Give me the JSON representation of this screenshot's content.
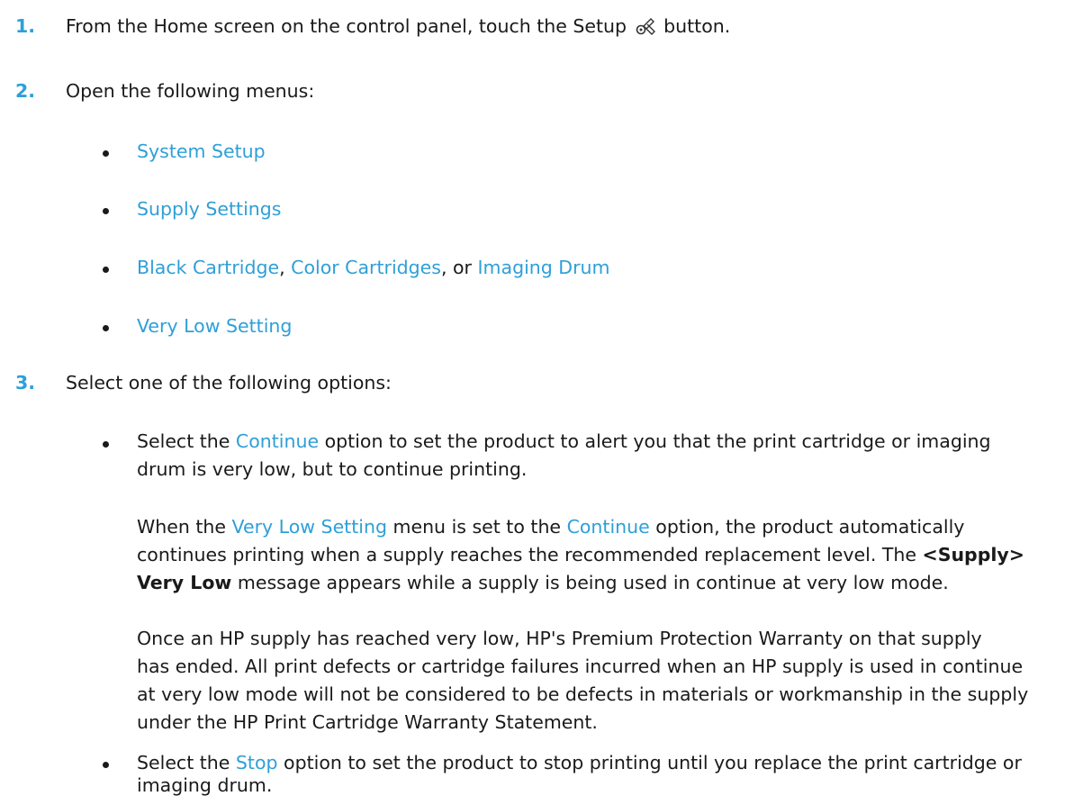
{
  "step1": {
    "number": "1.",
    "text_before": "From the Home screen on the control panel, touch the Setup",
    "icon": "setup-wrench-icon",
    "text_after": "button."
  },
  "step2": {
    "number": "2.",
    "text": "Open the following menus:",
    "menus": [
      {
        "a": "System Setup"
      },
      {
        "a": "Supply Settings"
      },
      {
        "a": "Black Cartridge",
        "sep1": ", ",
        "b": "Color Cartridges",
        "sep2": ", or ",
        "c": "Imaging Drum"
      },
      {
        "a": "Very Low Setting"
      }
    ]
  },
  "step3": {
    "number": "3.",
    "text": "Select one of the following options:",
    "continue_option": {
      "l1_a": "Select the ",
      "l1_link": "Continue",
      "l1_b": " option to set the product to alert you that the print cartridge or imaging",
      "l2": "drum is very low, but to continue printing."
    },
    "para1": {
      "l1_a": "When the ",
      "l1_link1": "Very Low Setting",
      "l1_b": " menu is set to the ",
      "l1_link2": "Continue",
      "l1_c": " option, the product automatically",
      "l2_a": "continues printing when a supply reaches the recommended replacement level. The ",
      "l2_bold": "<Supply>",
      "l3_bold": "Very Low",
      "l3_b": " message appears while a supply is being used in continue at very low mode."
    },
    "para2": [
      "Once an HP supply has reached very low, HP's Premium Protection Warranty on that supply",
      "has ended. All print defects or cartridge failures incurred when an HP supply is used in continue",
      "at very low mode will not be considered to be defects in materials or workmanship in the supply",
      "under the HP Print Cartridge Warranty Statement."
    ],
    "stop_option": {
      "l1_a": "Select the ",
      "l1_link": "Stop",
      "l1_b": " option to set the product to stop printing until you replace the print cartridge or",
      "l2": "imaging drum."
    }
  }
}
